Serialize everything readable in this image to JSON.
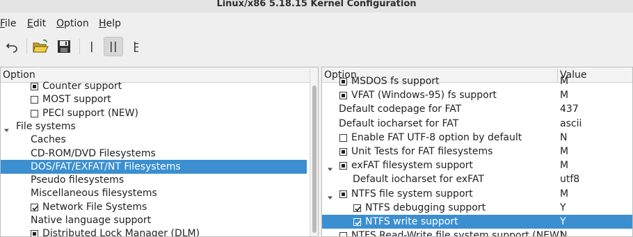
{
  "window": {
    "title": "Linux/x86 5.18.15 Kernel Configuration"
  },
  "menubar": {
    "items": [
      {
        "label": "File",
        "accel": "F",
        "rest": "ile"
      },
      {
        "label": "Edit",
        "accel": "E",
        "rest": "dit"
      },
      {
        "label": "Option",
        "accel": "O",
        "rest": "ption"
      },
      {
        "label": "Help",
        "accel": "H",
        "rest": "elp"
      }
    ]
  },
  "toolbar": {
    "buttons": [
      {
        "name": "undo-icon"
      },
      {
        "name": "open-folder-icon"
      },
      {
        "name": "save-icon"
      },
      {
        "name": "single-view-icon"
      },
      {
        "name": "split-view-icon",
        "active": true
      },
      {
        "name": "full-view-icon"
      }
    ]
  },
  "left_pane": {
    "header": "Option",
    "rows": [
      {
        "label": "Counter support",
        "checkbox": "mod",
        "indent": 1
      },
      {
        "label": "MOST support",
        "checkbox": "off",
        "indent": 1
      },
      {
        "label": "PECI support (NEW)",
        "checkbox": "off",
        "indent": 1
      },
      {
        "label": "File systems",
        "arrow": "down",
        "indent": 0
      },
      {
        "label": "Caches",
        "indent": 1
      },
      {
        "label": "CD-ROM/DVD Filesystems",
        "indent": 1
      },
      {
        "label": "DOS/FAT/EXFAT/NT Filesystems",
        "indent": 1,
        "selected": true
      },
      {
        "label": "Pseudo filesystems",
        "indent": 1
      },
      {
        "label": "Miscellaneous filesystems",
        "indent": 1
      },
      {
        "label": "Network File Systems",
        "checkbox": "on",
        "indent": 1
      },
      {
        "label": "Native language support",
        "indent": 1
      },
      {
        "label": "Distributed Lock Manager (DLM)",
        "checkbox": "mod",
        "indent": 1
      }
    ]
  },
  "right_pane": {
    "header_option": "Option",
    "header_value": "Value",
    "rows": [
      {
        "label": "MSDOS fs support",
        "checkbox": "mod",
        "value": "M",
        "indent": 1
      },
      {
        "label": "VFAT (Windows-95) fs support",
        "checkbox": "mod",
        "value": "M",
        "indent": 1
      },
      {
        "label": "Default codepage for FAT",
        "value": "437",
        "indent": 1
      },
      {
        "label": "Default iocharset for FAT",
        "value": "ascii",
        "indent": 1
      },
      {
        "label": "Enable FAT UTF-8 option by default",
        "checkbox": "off",
        "value": "N",
        "indent": 1
      },
      {
        "label": "Unit Tests for FAT filesystems",
        "checkbox": "mod",
        "value": "M",
        "indent": 1
      },
      {
        "label": "exFAT filesystem support",
        "checkbox": "mod",
        "arrow": "down",
        "value": "M",
        "indent": 0
      },
      {
        "label": "Default iocharset for exFAT",
        "value": "utf8",
        "indent": 2
      },
      {
        "label": "NTFS file system support",
        "checkbox": "mod",
        "arrow": "down",
        "value": "M",
        "indent": 0
      },
      {
        "label": "NTFS debugging support",
        "checkbox": "on",
        "value": "Y",
        "indent": 2
      },
      {
        "label": "NTFS write support",
        "checkbox": "on",
        "value": "Y",
        "indent": 2,
        "selected": true
      },
      {
        "label": "NTFS Read-Write file system support (NEW)",
        "checkbox": "off",
        "value": "N",
        "indent": 1
      }
    ]
  },
  "colors": {
    "selection": "#3b8fd0",
    "background": "#efefef",
    "pane": "#ffffff"
  }
}
